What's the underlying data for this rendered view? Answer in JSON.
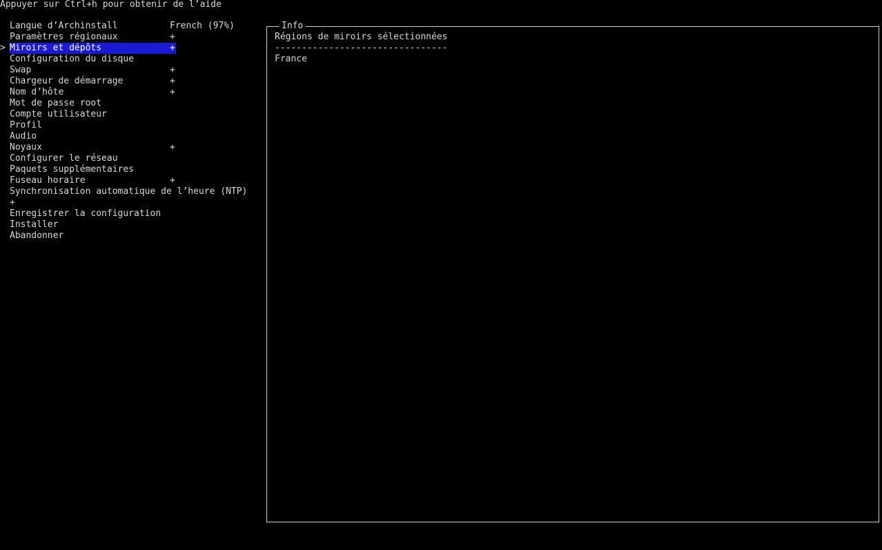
{
  "help_text": "Appuyer sur Ctrl+h pour obtenir de l’aide",
  "menu": {
    "pointer": ">",
    "items": [
      {
        "label": "Langue d’Archinstall",
        "value": "French (97%)"
      },
      {
        "label": "Paramètres régionaux",
        "value": "+"
      },
      {
        "label": "Miroirs et dépôts",
        "value": "+"
      },
      {
        "label": "Configuration du disque",
        "value": ""
      },
      {
        "label": "Swap",
        "value": "+"
      },
      {
        "label": "Chargeur de démarrage",
        "value": "+"
      },
      {
        "label": "Nom d’hôte",
        "value": "+"
      },
      {
        "label": "Mot de passe root",
        "value": ""
      },
      {
        "label": "Compte utilisateur",
        "value": ""
      },
      {
        "label": "Profil",
        "value": ""
      },
      {
        "label": "Audio",
        "value": ""
      },
      {
        "label": "Noyaux",
        "value": "+"
      },
      {
        "label": "Configurer le réseau",
        "value": ""
      },
      {
        "label": "Paquets supplémentaires",
        "value": ""
      },
      {
        "label": "Fuseau horaire",
        "value": "+"
      },
      {
        "label": "Synchronisation automatique de l’heure (NTP)",
        "value": ""
      },
      {
        "label": "+",
        "value": ""
      },
      {
        "label": "Enregistrer la configuration",
        "value": ""
      },
      {
        "label": "Installer",
        "value": ""
      },
      {
        "label": "Abandonner",
        "value": ""
      }
    ]
  },
  "info": {
    "title": "Info",
    "heading": "Régions de miroirs sélectionnées",
    "separator": "--------------------------------",
    "regions": [
      "France"
    ]
  },
  "colors": {
    "background": "#000000",
    "foreground": "#d8d8d8",
    "selection": "#1a1ad4"
  }
}
